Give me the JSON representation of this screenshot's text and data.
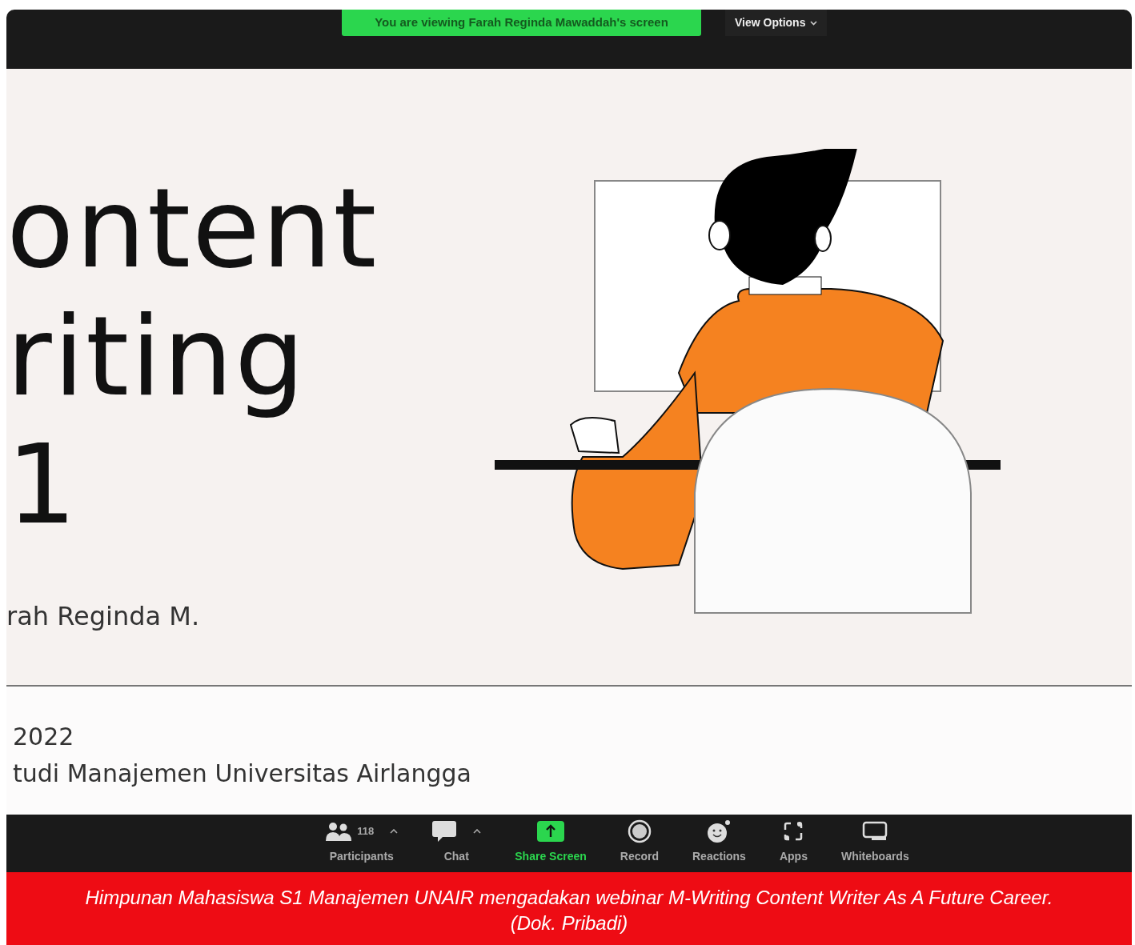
{
  "top_bar": {
    "banner": "You are viewing Farah Reginda Mawaddah's screen",
    "view_options": "View Options"
  },
  "slide": {
    "title_lines": [
      "ontent",
      "riting",
      "1"
    ],
    "presenter": "rah Reginda M.",
    "date": "2022",
    "institution": "tudi Manajemen Universitas Airlangga"
  },
  "toolbar": [
    {
      "kind": "participants",
      "label": "Participants",
      "count": "118",
      "caret": true
    },
    {
      "kind": "chat",
      "label": "Chat",
      "caret": true
    },
    {
      "kind": "share",
      "label": "Share Screen",
      "caret": false
    },
    {
      "kind": "record",
      "label": "Record",
      "caret": false
    },
    {
      "kind": "reactions",
      "label": "Reactions",
      "caret": false
    },
    {
      "kind": "apps",
      "label": "Apps",
      "caret": false
    },
    {
      "kind": "whiteboards",
      "label": "Whiteboards",
      "caret": false
    }
  ],
  "caption": {
    "lines": [
      "Himpunan Mahasiswa S1 Manajemen UNAIR mengadakan webinar M-Writing Content Writer As A Future Career.",
      "(Dok. Pribadi)"
    ]
  }
}
